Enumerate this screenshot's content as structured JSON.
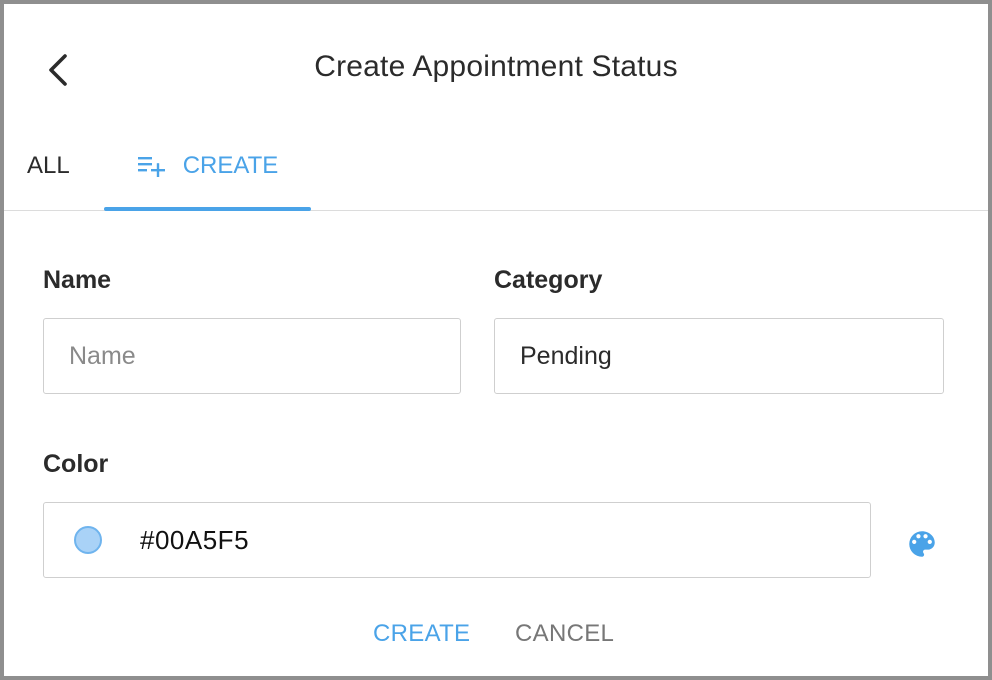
{
  "header": {
    "title": "Create Appointment Status",
    "back_icon": "chevron-left-icon"
  },
  "tabs": [
    {
      "label": "ALL",
      "active": false
    },
    {
      "label": "CREATE",
      "active": true,
      "icon": "playlist-add-icon"
    }
  ],
  "form": {
    "name": {
      "label": "Name",
      "value": "",
      "placeholder": "Name"
    },
    "category": {
      "label": "Category",
      "value": "Pending"
    },
    "color": {
      "label": "Color",
      "value": "#00A5F5",
      "picker_icon": "palette-icon"
    }
  },
  "actions": {
    "create_label": "CREATE",
    "cancel_label": "CANCEL"
  },
  "colors": {
    "accent": "#4aa3e8",
    "text": "#2b2b2b",
    "muted": "#777777",
    "swatch": "#a9d2f7"
  }
}
